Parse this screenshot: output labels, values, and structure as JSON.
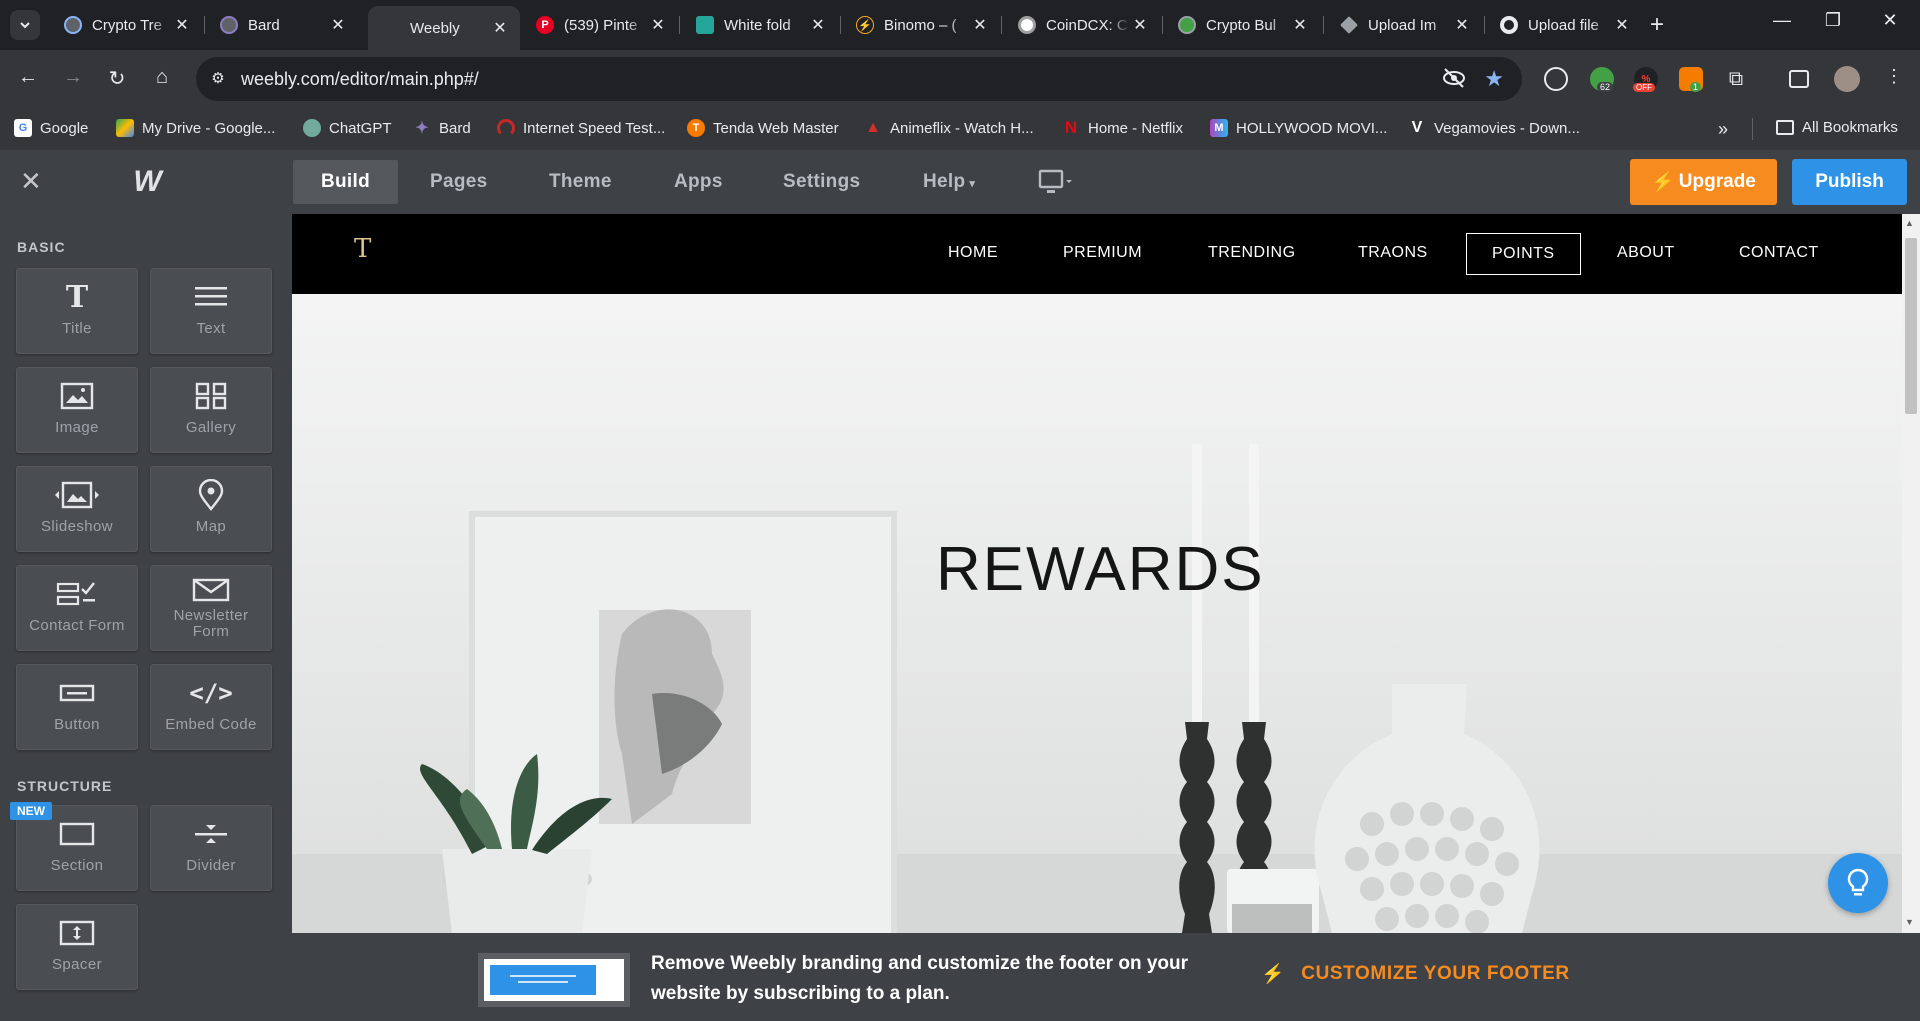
{
  "browser": {
    "tabs": [
      {
        "label": "Crypto Tre",
        "favicon_color": "#8ab4f8"
      },
      {
        "label": "Bard",
        "favicon_color": "#8e7cc3"
      },
      {
        "label": "Weebly",
        "favicon_color": "#35363a"
      },
      {
        "label": "(539) Pinte",
        "favicon_color": "#e60023"
      },
      {
        "label": "White fold",
        "favicon_color": "#26a69a"
      },
      {
        "label": "Binomo – (",
        "favicon_color": "#f9a825"
      },
      {
        "label": "CoinDCX: C",
        "favicon_color": "#9e9e9e"
      },
      {
        "label": "Crypto Bul",
        "favicon_color": "#43a047"
      },
      {
        "label": "Upload Im",
        "favicon_color": "#9aa0a6"
      },
      {
        "label": "Upload file",
        "favicon_color": "#e8eaed"
      }
    ],
    "url": "weebly.com/editor/main.php#/",
    "extension_badges": {
      "ext1": "62",
      "ext2": "OFF",
      "ext3": "1"
    },
    "bookmarks": [
      {
        "label": "Google",
        "icon_color": "#4285f4"
      },
      {
        "label": "My Drive - Google...",
        "icon_color": "#fbbc04"
      },
      {
        "label": "ChatGPT",
        "icon_color": "#74aa9c"
      },
      {
        "label": "Bard",
        "icon_color": "#8e7cc3"
      },
      {
        "label": "Internet Speed Test...",
        "icon_color": "#c62828"
      },
      {
        "label": "Tenda Web Master",
        "icon_color": "#f57c00"
      },
      {
        "label": "Animeflix - Watch H...",
        "icon_color": "#d32f2f"
      },
      {
        "label": "Home - Netflix",
        "icon_color": "#e50914"
      },
      {
        "label": "HOLLYWOOD MOVI...",
        "icon_color": "#ab47bc"
      },
      {
        "label": "Vegamovies - Down...",
        "icon_color": "#ffffff"
      }
    ],
    "all_bookmarks_label": "All Bookmarks"
  },
  "editor": {
    "tabs": [
      "Build",
      "Pages",
      "Theme",
      "Apps",
      "Settings",
      "Help"
    ],
    "upgrade_label": "Upgrade",
    "publish_label": "Publish",
    "basic_label": "BASIC",
    "structure_label": "STRUCTURE",
    "new_badge": "NEW",
    "elements": {
      "title": "Title",
      "text": "Text",
      "image": "Image",
      "gallery": "Gallery",
      "slideshow": "Slideshow",
      "map": "Map",
      "contact_form": "Contact Form",
      "newsletter_form_1": "Newsletter",
      "newsletter_form_2": "Form",
      "button": "Button",
      "embed_code": "Embed Code",
      "section": "Section",
      "divider": "Divider",
      "spacer": "Spacer"
    }
  },
  "site": {
    "logo": "T",
    "nav": [
      "HOME",
      "PREMIUM",
      "TRENDING",
      "TRAONS",
      "POINTS",
      "ABOUT",
      "CONTACT"
    ],
    "hero_title": "REWARDS"
  },
  "footer_promo": {
    "text": "Remove Weebly branding and customize the footer on your website by subscribing to a plan.",
    "cta": "CUSTOMIZE YOUR FOOTER"
  },
  "colors": {
    "accent_orange": "#f68b1f",
    "accent_blue": "#2e93e6",
    "panel_bg": "#3e4146"
  }
}
